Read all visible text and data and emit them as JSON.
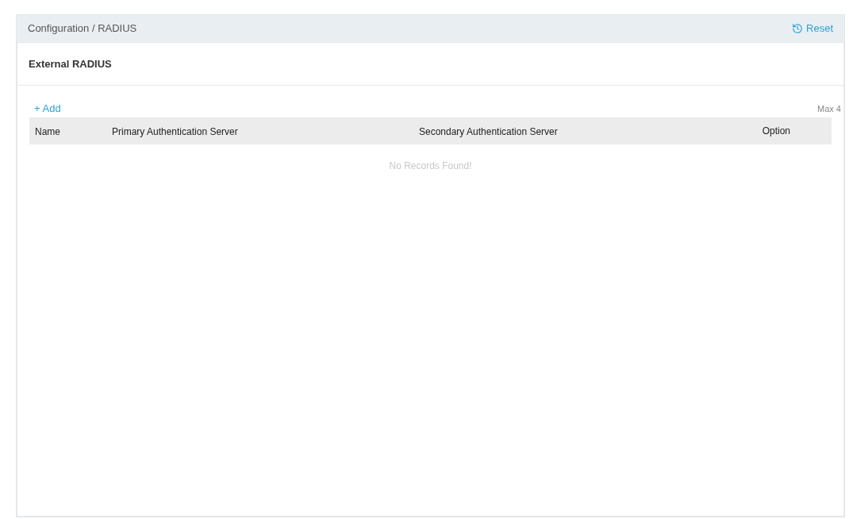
{
  "breadcrumb": "Configuration / RADIUS",
  "reset_link": {
    "label": "Reset"
  },
  "card": {
    "title": "External RADIUS"
  },
  "toolbar": {
    "add_label": "+ Add",
    "limit": "Max 4"
  },
  "table": {
    "columns": [
      "Name",
      "Primary Authentication Server",
      "Secondary Authentication Server",
      "Option"
    ],
    "empty_message": "No Records Found!"
  }
}
